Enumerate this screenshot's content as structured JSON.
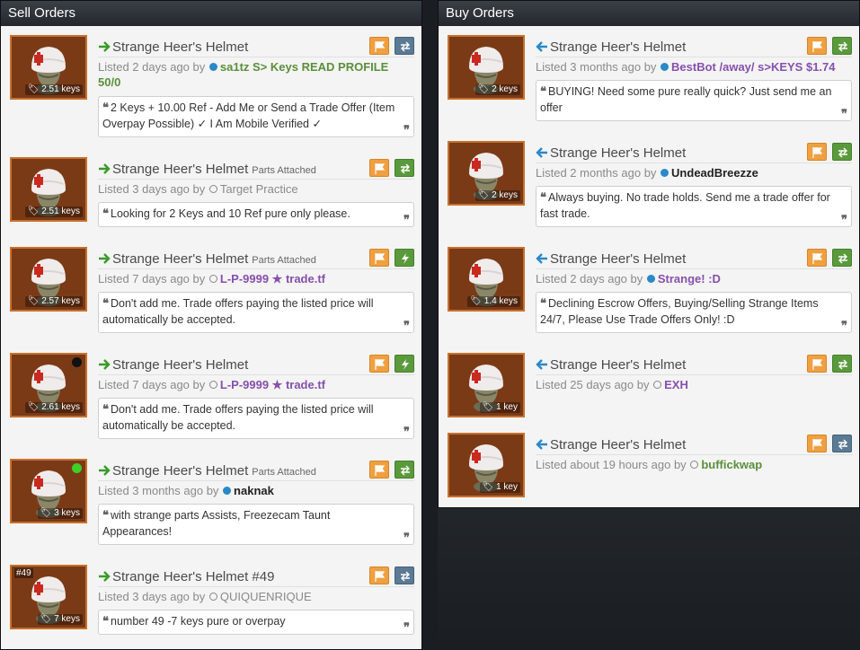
{
  "colors": {
    "flag_orange": "#f0a040",
    "trade_gray": "#5b7a94",
    "trade_green": "#5a9a3c",
    "unusual_item_bg": "#7b3a16"
  },
  "sell": {
    "header": "Sell Orders",
    "listings": [
      {
        "title": "Strange Heer's Helmet",
        "extra": "",
        "price": "2.51 keys",
        "listed": "Listed 2 days ago by",
        "user": "sa1tz S> Keys READ PROFILE 50/0",
        "comment": "2 Keys + 10.00 Ref - Add Me or Send a Trade Offer (Item Overpay Possible) ✓ I Am Mobile Verified ✓"
      },
      {
        "title": "Strange Heer's Helmet",
        "extra": "Parts Attached",
        "price": "2.51 keys",
        "listed": "Listed 3 days ago by",
        "user": "Target Practice",
        "comment": "Looking for 2 Keys and 10 Ref pure only please."
      },
      {
        "title": "Strange Heer's Helmet",
        "extra": "Parts Attached",
        "price": "2.57 keys",
        "listed": "Listed 7 days ago by",
        "user": "L-P-9999 ★ trade.tf",
        "comment": "Don't add me. Trade offers paying the listed price will automatically be accepted."
      },
      {
        "title": "Strange Heer's Helmet",
        "extra": "",
        "price": "2.61 keys",
        "listed": "Listed 7 days ago by",
        "user": "L-P-9999 ★ trade.tf",
        "comment": "Don't add me. Trade offers paying the listed price will automatically be accepted."
      },
      {
        "title": "Strange Heer's Helmet",
        "extra": "Parts Attached",
        "price": "3 keys",
        "listed": "Listed 3 months ago by",
        "user": "naknak",
        "comment": "with strange parts Assists, Freezecam Taunt Appearances!"
      },
      {
        "title": "Strange Heer's Helmet #49",
        "extra": "",
        "price": "7 keys",
        "craft": "#49",
        "listed": "Listed 3 days ago by",
        "user": "QUIQUENRIQUE",
        "comment": "number 49 -7 keys pure or overpay"
      }
    ]
  },
  "buy": {
    "header": "Buy Orders",
    "listings": [
      {
        "title": "Strange Heer's Helmet",
        "price": "2 keys",
        "listed": "Listed 3 months ago by",
        "user": "BestBot /away/ s>KEYS $1.74",
        "comment": "BUYING! Need some pure really quick? Just send me an offer"
      },
      {
        "title": "Strange Heer's Helmet",
        "price": "2 keys",
        "listed": "Listed 2 months ago by",
        "user": "UndeadBreezze",
        "comment": "Always buying. No trade holds. Send me a trade offer for fast trade."
      },
      {
        "title": "Strange Heer's Helmet",
        "price": "1.4 keys",
        "listed": "Listed 2 days ago by",
        "user": "Strange! :D",
        "comment": "Declining Escrow Offers, Buying/Selling Strange Items 24/7, Please Use Trade Offers Only! :D"
      },
      {
        "title": "Strange Heer's Helmet",
        "price": "1 key",
        "listed": "Listed 25 days ago by",
        "user": "EXH",
        "comment": ""
      },
      {
        "title": "Strange Heer's Helmet",
        "price": "1 key",
        "listed": "Listed about 19 hours ago by",
        "user": "buffickwap",
        "comment": ""
      }
    ]
  }
}
